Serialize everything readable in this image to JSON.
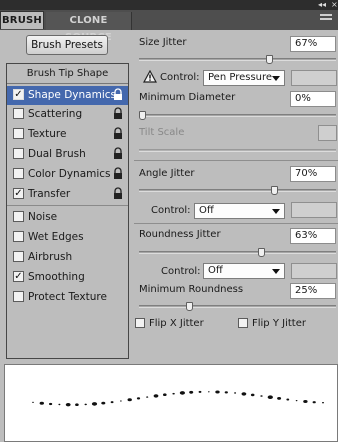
{
  "tabs": {
    "brush": "BRUSH",
    "clone_source": "CLONE SOURCE"
  },
  "window_controls": {
    "collapse": "◂◂",
    "close": "×"
  },
  "brush_presets_button": "Brush Presets",
  "left_panel": {
    "header": "Brush Tip Shape",
    "items": [
      {
        "label": "Shape Dynamics",
        "checked": true,
        "selected": true
      },
      {
        "label": "Scattering",
        "checked": false
      },
      {
        "label": "Texture",
        "checked": false
      },
      {
        "label": "Dual Brush",
        "checked": false
      },
      {
        "label": "Color Dynamics",
        "checked": false
      },
      {
        "label": "Transfer",
        "checked": true
      },
      {
        "label": "Noise",
        "checked": false
      },
      {
        "label": "Wet Edges",
        "checked": false
      },
      {
        "label": "Airbrush",
        "checked": false
      },
      {
        "label": "Smoothing",
        "checked": true
      },
      {
        "label": "Protect Texture",
        "checked": false
      }
    ]
  },
  "check_mark": "✓",
  "size_jitter": {
    "label": "Size Jitter",
    "value": "67%",
    "level": 0.67
  },
  "size_control": {
    "label": "Control:",
    "value": "Pen Pressure",
    "warning_icon": "warning-triangle-icon"
  },
  "minimum_diameter": {
    "label": "Minimum Diameter",
    "value": "0%",
    "level": 0.0
  },
  "tilt_scale": {
    "label": "Tilt Scale",
    "disabled": true
  },
  "angle_jitter": {
    "label": "Angle Jitter",
    "value": "70%",
    "level": 0.7
  },
  "angle_control": {
    "label": "Control:",
    "value": "Off"
  },
  "roundness_jitter": {
    "label": "Roundness Jitter",
    "value": "63%",
    "level": 0.63
  },
  "roundness_control": {
    "label": "Control:",
    "value": "Off"
  },
  "minimum_roundness": {
    "label": "Minimum Roundness",
    "value": "25%",
    "level": 0.25
  },
  "flip_x": {
    "label": "Flip X Jitter",
    "checked": false
  },
  "flip_y": {
    "label": "Flip Y Jitter",
    "checked": false
  },
  "colors": {
    "selection": "#4468ad",
    "panel": "#bdbdbd",
    "tabbar": "#4e4e4e"
  }
}
